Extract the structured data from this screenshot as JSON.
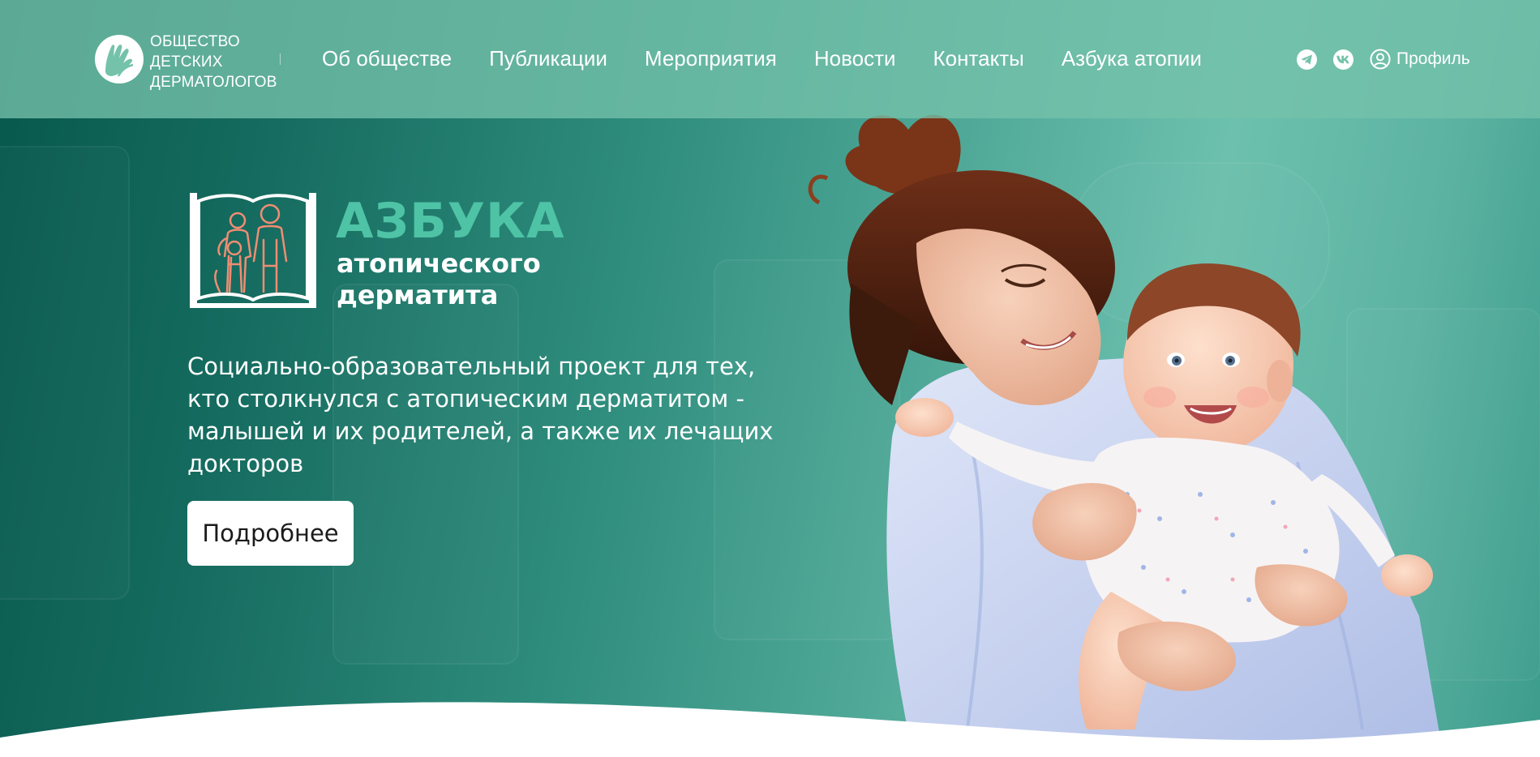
{
  "brand": {
    "logo_lines": [
      "ОБЩЕСТВО",
      "ДЕТСКИХ",
      "ДЕРМАТОЛОГОВ"
    ],
    "logo_icon": "hands-logo-icon"
  },
  "nav": {
    "items": [
      {
        "label": "Об обществе"
      },
      {
        "label": "Публикации"
      },
      {
        "label": "Мероприятия"
      },
      {
        "label": "Новости"
      },
      {
        "label": "Контакты"
      },
      {
        "label": "Азбука атопии"
      }
    ]
  },
  "header_right": {
    "telegram_icon": "telegram-icon",
    "vk_icon": "vk-icon",
    "profile_icon": "user-circle-icon",
    "profile_label": "Профиль"
  },
  "hero": {
    "logo_title": "АЗБУКА",
    "logo_sub_lines": [
      "атопического",
      "дерматита"
    ],
    "book_icon": "family-book-icon",
    "description_lines": [
      "Социально-образовательный проект для тех,",
      "кто столкнулся с атопическим дерматитом -",
      "малышей и их родителей, а также их лечащих",
      "докторов"
    ],
    "cta_label": "Подробнее",
    "photo": "mother-with-baby-photo"
  },
  "colors": {
    "header_bg": "#74c2aa",
    "hero_dark": "#07584c",
    "hero_light": "#6cc0ad",
    "accent_title": "#4ec3a5",
    "book_figures": "#f08d73",
    "button_bg": "#ffffff"
  }
}
